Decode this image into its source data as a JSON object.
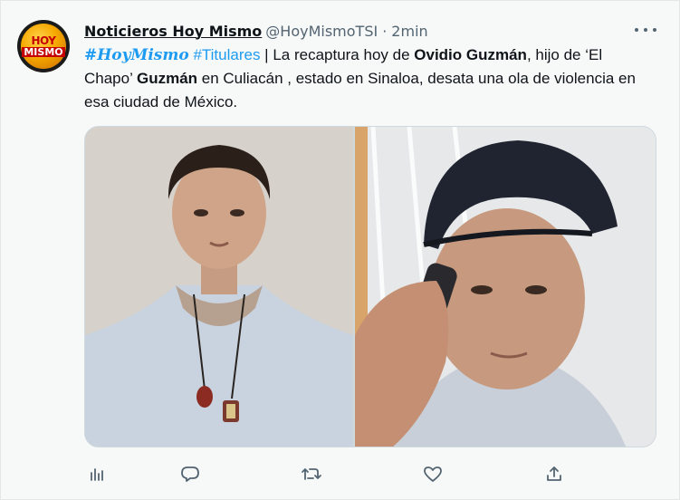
{
  "tweet": {
    "author_name": "Noticieros Hoy Mismo",
    "author_handle": "@HoyMismoTSI",
    "separator": "·",
    "timestamp": "2min",
    "avatar_text_top": "HOY",
    "avatar_text_bottom": "MISMO",
    "body": {
      "hashtag1": "#HoyMismo",
      "hashtag2": "#Titulares",
      "part1": " | La recaptura hoy de ",
      "bold1": "Ovidio Guzmán",
      "part2": ", hijo de ‘El Chapo’ ",
      "bold2": "Guzmán",
      "part3": " en Culiacán , estado en Sinaloa, desata una ola de violencia en esa ciudad de México."
    },
    "media": [
      {
        "icon": "photo"
      },
      {
        "icon": "photo"
      }
    ]
  },
  "actions": [
    {
      "icon": "analytics-icon"
    },
    {
      "icon": "reply-icon"
    },
    {
      "icon": "retweet-icon"
    },
    {
      "icon": "like-icon"
    },
    {
      "icon": "share-icon"
    }
  ],
  "colors": {
    "link": "#1d9bf0",
    "text": "#0f1419",
    "secondary": "#536471",
    "background": "#f7f9f9"
  }
}
